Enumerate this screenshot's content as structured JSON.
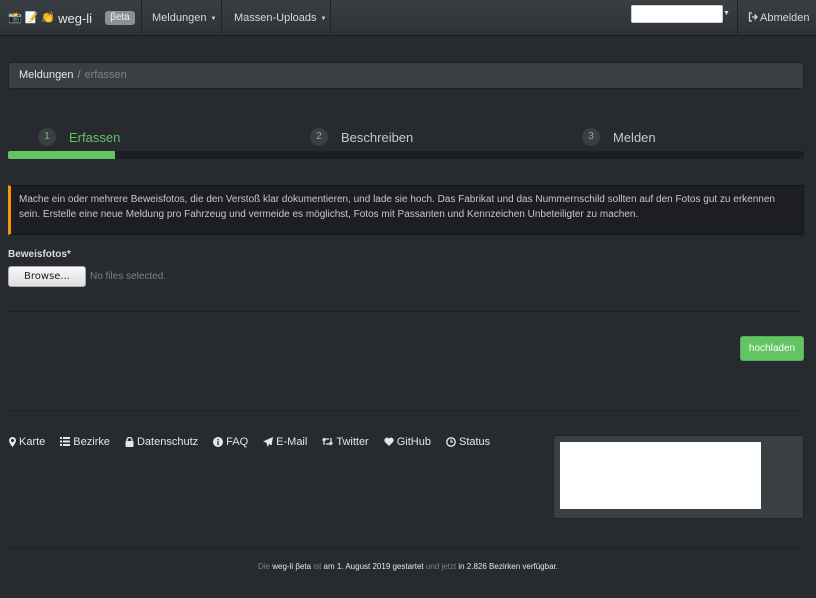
{
  "nav": {
    "brand": "weg-li",
    "brand_badge": "βeta",
    "menu_reports": "Meldungen",
    "menu_bulk": "Massen-Uploads",
    "logout": "Abmelden"
  },
  "breadcrumb": {
    "parent": "Meldungen",
    "separator": "/",
    "current": "erfassen"
  },
  "steps": [
    {
      "number": "1",
      "label": "Erfassen",
      "active": true
    },
    {
      "number": "2",
      "label": "Beschreiben",
      "active": false
    },
    {
      "number": "3",
      "label": "Melden",
      "active": false
    }
  ],
  "progress": {
    "percent": 13.5
  },
  "alert": {
    "text": "Mache ein oder mehrere Beweisfotos, die den Verstoß klar dokumentieren, und lade sie hoch. Das Fabrikat und das Nummernschild sollten auf den Fotos gut zu erkennen sein. Erstelle eine neue Meldung pro Fahrzeug und vermeide es möglichst, Fotos mit Passanten und Kennzeichen Unbeteiligter zu machen."
  },
  "form": {
    "photos_label": "Beweisfotos*",
    "browse_label": "Browse...",
    "no_files": "No files selected.",
    "upload_label": "hochladen"
  },
  "footer": {
    "links": [
      {
        "label": "Karte",
        "icon": "map-marker-icon"
      },
      {
        "label": "Bezirke",
        "icon": "list-icon"
      },
      {
        "label": "Datenschutz",
        "icon": "lock-icon"
      },
      {
        "label": "FAQ",
        "icon": "info-circle-icon"
      },
      {
        "label": "E-Mail",
        "icon": "paper-plane-icon"
      },
      {
        "label": "Twitter",
        "icon": "retweet-icon"
      },
      {
        "label": "GitHub",
        "icon": "heart-icon"
      },
      {
        "label": "Status",
        "icon": "clock-icon"
      }
    ],
    "t1": "Die",
    "t2": "weg-li βeta",
    "t3": "ist",
    "t4": "am 1. August 2019 gestartet",
    "t5": "und",
    "t6": "jetzt",
    "t7": "in 2.826 Bezirken verfügbar",
    "t8": "."
  },
  "colors": {
    "background": "#272b30",
    "navbar": "#3a3f44",
    "success": "#62c462",
    "warning": "#f89406"
  }
}
